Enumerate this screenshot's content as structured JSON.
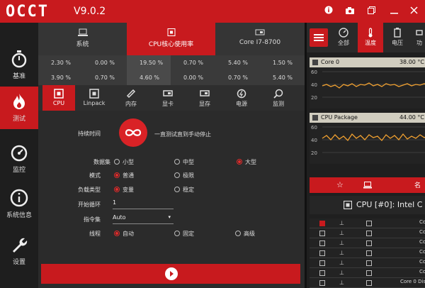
{
  "titlebar": {
    "logo": "OCCT",
    "version": "V9.0.2",
    "icons": [
      "info-icon",
      "camera-icon",
      "restore-icon",
      "minimize-icon",
      "close-icon"
    ]
  },
  "sidebar": {
    "items": [
      {
        "label": "基准",
        "icon": "stopwatch-icon"
      },
      {
        "label": "测试",
        "icon": "flame-icon",
        "active": true
      },
      {
        "label": "监控",
        "icon": "gauge-icon"
      },
      {
        "label": "系统信息",
        "icon": "info-circle-icon"
      },
      {
        "label": "设置",
        "icon": "wrench-icon"
      }
    ]
  },
  "stats": {
    "tabs": [
      {
        "label": "系统"
      },
      {
        "label": "CPU核心使用率",
        "active": true
      },
      {
        "label": "Core I7-8700"
      }
    ],
    "rows": [
      [
        "2.30 %",
        "0.00 %",
        "19.50 %",
        "0.70 %",
        "5.40 %",
        "1.50 %"
      ],
      [
        "3.90 %",
        "0.70 %",
        "4.60 %",
        "0.00 %",
        "0.70 %",
        "5.40 %"
      ]
    ]
  },
  "subtabs": [
    {
      "label": "CPU",
      "active": true
    },
    {
      "label": "Linpack"
    },
    {
      "label": "内存"
    },
    {
      "label": "显卡"
    },
    {
      "label": "显存"
    },
    {
      "label": "电源"
    },
    {
      "label": "监测"
    }
  ],
  "form": {
    "duration_label": "持续时间",
    "duration_text": "一直测试直到手动停止",
    "dataset_label": "数据集",
    "dataset_options": [
      "小型",
      "中型",
      "大型"
    ],
    "mode_label": "模式",
    "mode_options": [
      "普通",
      "极限"
    ],
    "load_label": "负载类型",
    "load_options": [
      "变量",
      "稳定"
    ],
    "start_cycle_label": "开始循环",
    "start_cycle_value": "1",
    "instruction_label": "指令集",
    "instruction_value": "Auto",
    "threads_label": "线程",
    "thread_options": [
      "自动",
      "固定",
      "高级"
    ]
  },
  "right": {
    "tabs": [
      {
        "label": "全部"
      },
      {
        "label": "温度",
        "active": true
      },
      {
        "label": "电压"
      },
      {
        "label": "功"
      }
    ],
    "graphs": [
      {
        "name": "Core 0",
        "value": "38.00 °C",
        "yticks": [
          "60",
          "40",
          "20"
        ]
      },
      {
        "name": "CPU Package",
        "value": "44.00 °C",
        "yticks": [
          "60",
          "40",
          "20"
        ]
      }
    ],
    "device_title": "CPU [#0]: Intel C",
    "sensor_rows": [
      {
        "name": "Co",
        "checked": true
      },
      {
        "name": "Co",
        "checked": false
      },
      {
        "name": "Co",
        "checked": false
      },
      {
        "name": "Co",
        "checked": false
      },
      {
        "name": "Co",
        "checked": false
      },
      {
        "name": "Co",
        "checked": false
      },
      {
        "name": "Core 0 Dista",
        "checked": false
      }
    ]
  },
  "colors": {
    "accent": "#c81a1e",
    "graph_line": "#f0a030"
  }
}
